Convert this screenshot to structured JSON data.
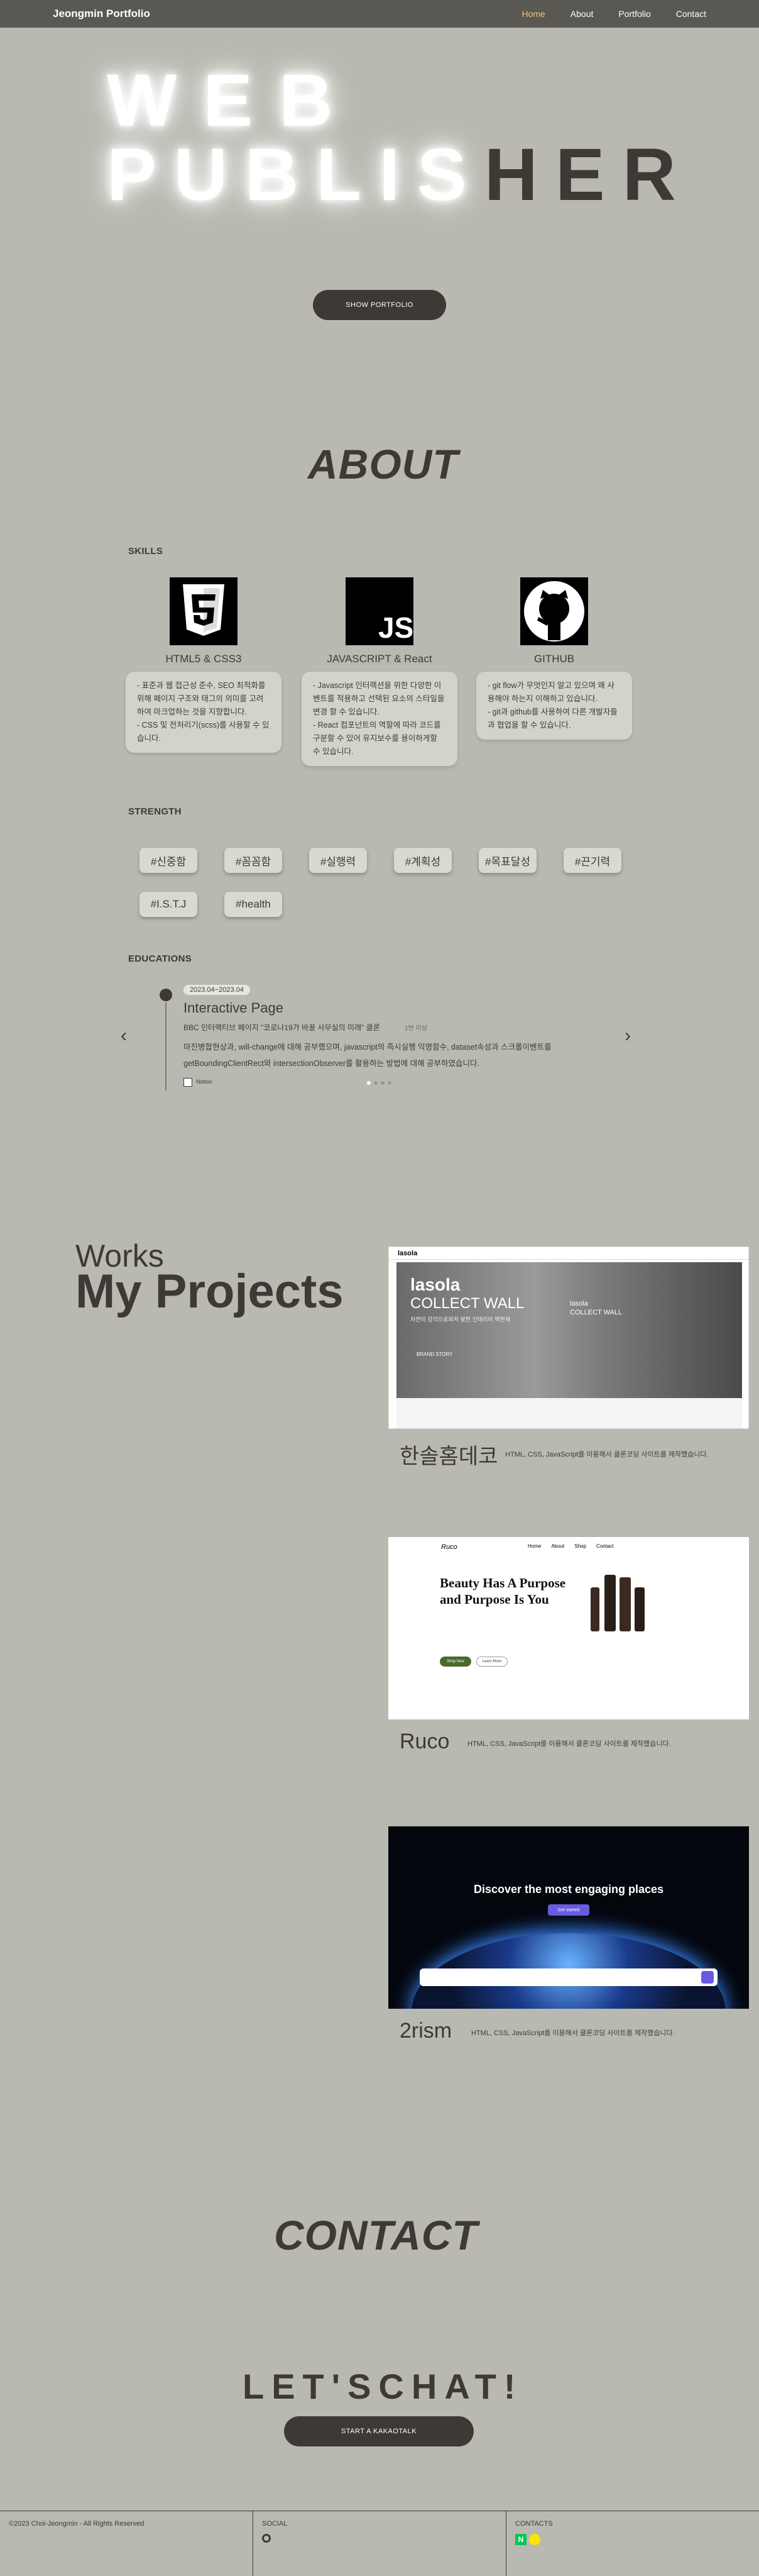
{
  "nav": {
    "brand": "Jeongmin Portfolio",
    "items": [
      {
        "label": "Home",
        "active": true
      },
      {
        "label": "About",
        "active": false
      },
      {
        "label": "Portfolio",
        "active": false
      },
      {
        "label": "Contact",
        "active": false
      }
    ]
  },
  "hero": {
    "line1": "WEB",
    "line2_glow": "PUBLIS",
    "line2_dark": "HER",
    "button": "SHOW PORTFOLIO"
  },
  "about": {
    "title": "ABOUT",
    "skills_label": "SKILLS",
    "skills": [
      {
        "icon": "html5-icon",
        "name": "HTML5 & CSS3",
        "desc": [
          "- 표준과 웹 접근성 준수, SEO 최적화를 위해 페이지 구조와 태그의 의미를 고려하여 마크업하는 것을 지향합니다.",
          "- CSS 및 전처리기(scss)를 사용할 수 있습니다."
        ]
      },
      {
        "icon": "javascript-icon",
        "name": "JAVASCRIPT & React",
        "desc": [
          "- Javascript 인터랙션을 위한 다양한 이벤트를 적용하고 선택된 요소의 스타일을 변경 할 수 있습니다.",
          "- React 컴포넌트의 역할에 따라 코드를 구분할 수 있어 유지보수를 용이하게할 수 있습니다."
        ]
      },
      {
        "icon": "github-icon",
        "name": "GITHUB",
        "desc": [
          "- git flow가 무엇인지 알고 있으며 왜 사용해야 하는지 이해하고 있습니다.",
          "- git과 github를 사용하여 다른 개발자들과 협업을 할 수 있습니다."
        ]
      }
    ],
    "strength_label": "STRENGTH",
    "tags": [
      "#신중함",
      "#꼼꼼함",
      "#실행력",
      "#계획성",
      "#목표달성",
      "#끈기력",
      "#I.S.T.J",
      "#health"
    ],
    "education_label": "EDUCATIONS",
    "education": {
      "period": "2023.04~2023.04",
      "title": "Interactive Page",
      "subtitle": "BBC 인터랙티브 페이지 \"코로나19가 바꿀 사무실의 미래\" 클론",
      "badge": "1번 이상",
      "details": [
        "마진병합현상과, will-change에 대해 공부했으며, javascript의 즉시실행 익명함수, dataset속성과 스크롤이벤트를",
        "getBoundingClientRect와 intersectionObserver를 활용하는 방법에 대해 공부하였습니다."
      ],
      "source": "Notion"
    }
  },
  "works": {
    "kicker": "Works",
    "title": "My Projects",
    "projects": [
      {
        "name": "한솔홈데코",
        "desc": "HTML, CSS, JavaScript를 이용해서 클론코딩 사이트를 제작했습니다.",
        "shot": {
          "logo": "lasola",
          "headline": "lasola",
          "headline2": "COLLECT WALL",
          "sub": "자연이 감각으로와져 발현 인테리어 벽판재",
          "side1": "lasola",
          "side2": "COLLECT WALL",
          "tag": "BRAND STORY"
        }
      },
      {
        "name": "Ruco",
        "desc": "HTML, CSS, JavaScript를 이용해서 클론코딩 사이트를 제작했습니다.",
        "shot": {
          "logo": "Ruco",
          "nav": [
            "Home",
            "About",
            "Shop",
            "Contact"
          ],
          "headline": "Beauty Has A Purpose and Purpose Is You",
          "btn1": "Shop Now",
          "btn2": "Learn More"
        }
      },
      {
        "name": "2rism",
        "desc": "HTML, CSS, JavaScript를 이용해서 클론코딩 사이트를 제작했습니다.",
        "shot": {
          "headline": "Discover the most engaging places",
          "btn": "Get started"
        }
      }
    ]
  },
  "contact": {
    "title": "CONTACT",
    "letschat": "LET'SCHAT!",
    "button": "START A KAKAOTALK"
  },
  "footer": {
    "copyright": "©2023 Choi-Jeongmin - All Rights Reserved",
    "social_label": "SOCIAL",
    "contacts_label": "CONTACTS"
  },
  "colors": {
    "background": "#b9b9b1",
    "dark": "#3d3a35",
    "nav": "#5a5852",
    "active": "#f0c47d"
  }
}
